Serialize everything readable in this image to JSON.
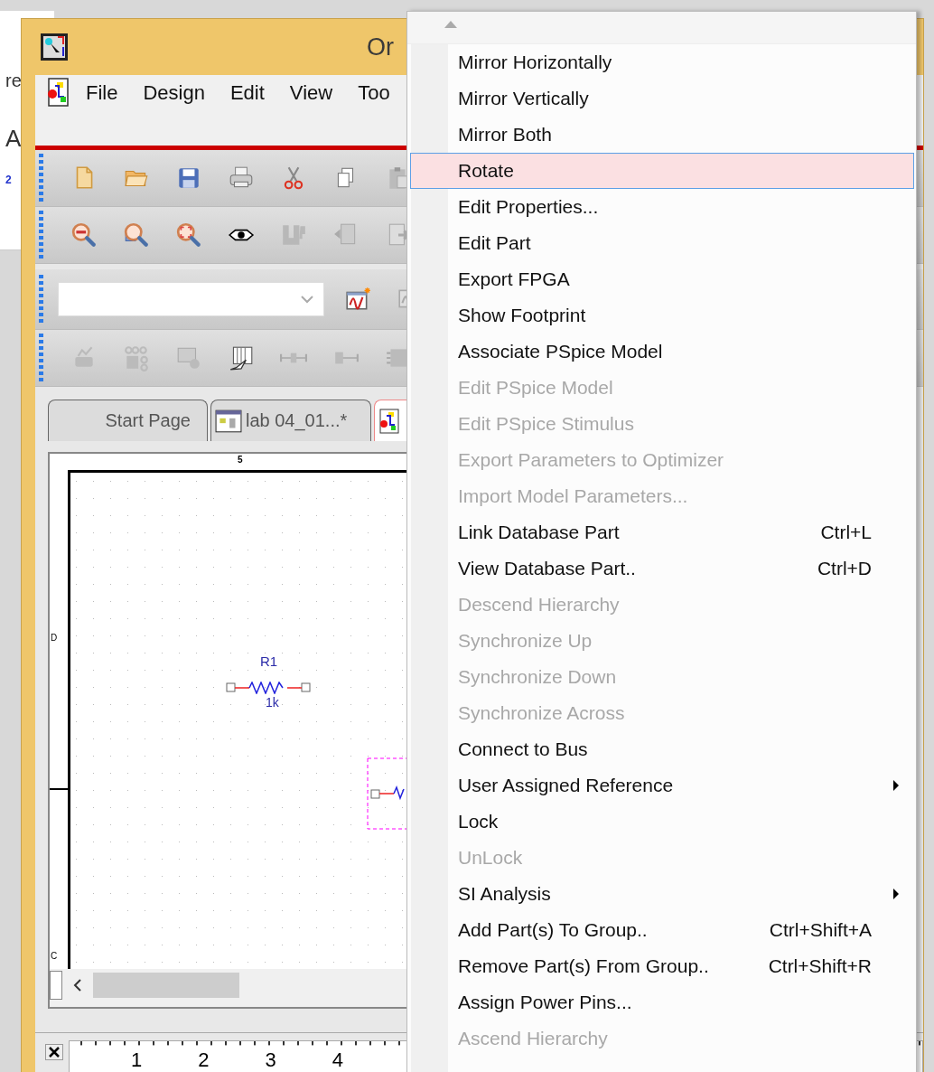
{
  "background_window": {
    "texts": [
      "re",
      "A",
      "2"
    ]
  },
  "window": {
    "title": "Or",
    "menu": [
      "File",
      "Design",
      "Edit",
      "View",
      "Too"
    ]
  },
  "tabs": [
    {
      "kind": "text",
      "label": "Start Page",
      "selected": false
    },
    {
      "kind": "file",
      "label": "lab 04_01...*",
      "selected": false
    },
    {
      "kind": "icon",
      "selected": true
    }
  ],
  "schematic": {
    "top_label": "5",
    "side_labels": [
      "D",
      "C"
    ],
    "parts": [
      {
        "ref": "R1",
        "value": "1k"
      }
    ]
  },
  "ruler": {
    "ticks": [
      "1",
      "2",
      "3",
      "4"
    ]
  },
  "context_menu": {
    "items": [
      {
        "label": "Mirror Horizontally",
        "disabled": false,
        "selected": false
      },
      {
        "label": "Mirror Vertically",
        "disabled": false,
        "selected": false
      },
      {
        "label": "Mirror Both",
        "disabled": false,
        "selected": false
      },
      {
        "label": "Rotate",
        "disabled": false,
        "selected": true
      },
      {
        "label": "Edit Properties...",
        "disabled": false,
        "selected": false
      },
      {
        "label": "Edit Part",
        "disabled": false,
        "selected": false
      },
      {
        "label": "Export FPGA",
        "disabled": false,
        "selected": false
      },
      {
        "label": "Show Footprint",
        "disabled": false,
        "selected": false
      },
      {
        "label": "Associate PSpice Model",
        "disabled": false,
        "selected": false
      },
      {
        "label": "Edit PSpice Model",
        "disabled": true,
        "selected": false
      },
      {
        "label": "Edit PSpice Stimulus",
        "disabled": true,
        "selected": false
      },
      {
        "label": "Export Parameters to Optimizer",
        "disabled": true,
        "selected": false
      },
      {
        "label": "Import Model Parameters...",
        "disabled": true,
        "selected": false
      },
      {
        "label": "Link Database Part",
        "shortcut": "Ctrl+L",
        "disabled": false,
        "selected": false
      },
      {
        "label": "View Database Part..",
        "shortcut": "Ctrl+D",
        "disabled": false,
        "selected": false
      },
      {
        "label": "Descend Hierarchy",
        "disabled": true,
        "selected": false
      },
      {
        "label": "Synchronize Up",
        "disabled": true,
        "selected": false
      },
      {
        "label": "Synchronize Down",
        "disabled": true,
        "selected": false
      },
      {
        "label": "Synchronize Across",
        "disabled": true,
        "selected": false
      },
      {
        "label": "Connect to Bus",
        "disabled": false,
        "selected": false
      },
      {
        "label": "User Assigned Reference",
        "submenu": true,
        "disabled": false,
        "selected": false
      },
      {
        "label": "Lock",
        "disabled": false,
        "selected": false
      },
      {
        "label": "UnLock",
        "disabled": true,
        "selected": false
      },
      {
        "label": "SI Analysis",
        "submenu": true,
        "disabled": false,
        "selected": false
      },
      {
        "label": "Add Part(s) To Group..",
        "shortcut": "Ctrl+Shift+A",
        "disabled": false,
        "selected": false
      },
      {
        "label": "Remove Part(s) From Group..",
        "shortcut": "Ctrl+Shift+R",
        "disabled": false,
        "selected": false
      },
      {
        "label": "Assign Power Pins...",
        "disabled": false,
        "selected": false
      },
      {
        "label": "Ascend Hierarchy",
        "disabled": true,
        "selected": false
      }
    ]
  }
}
